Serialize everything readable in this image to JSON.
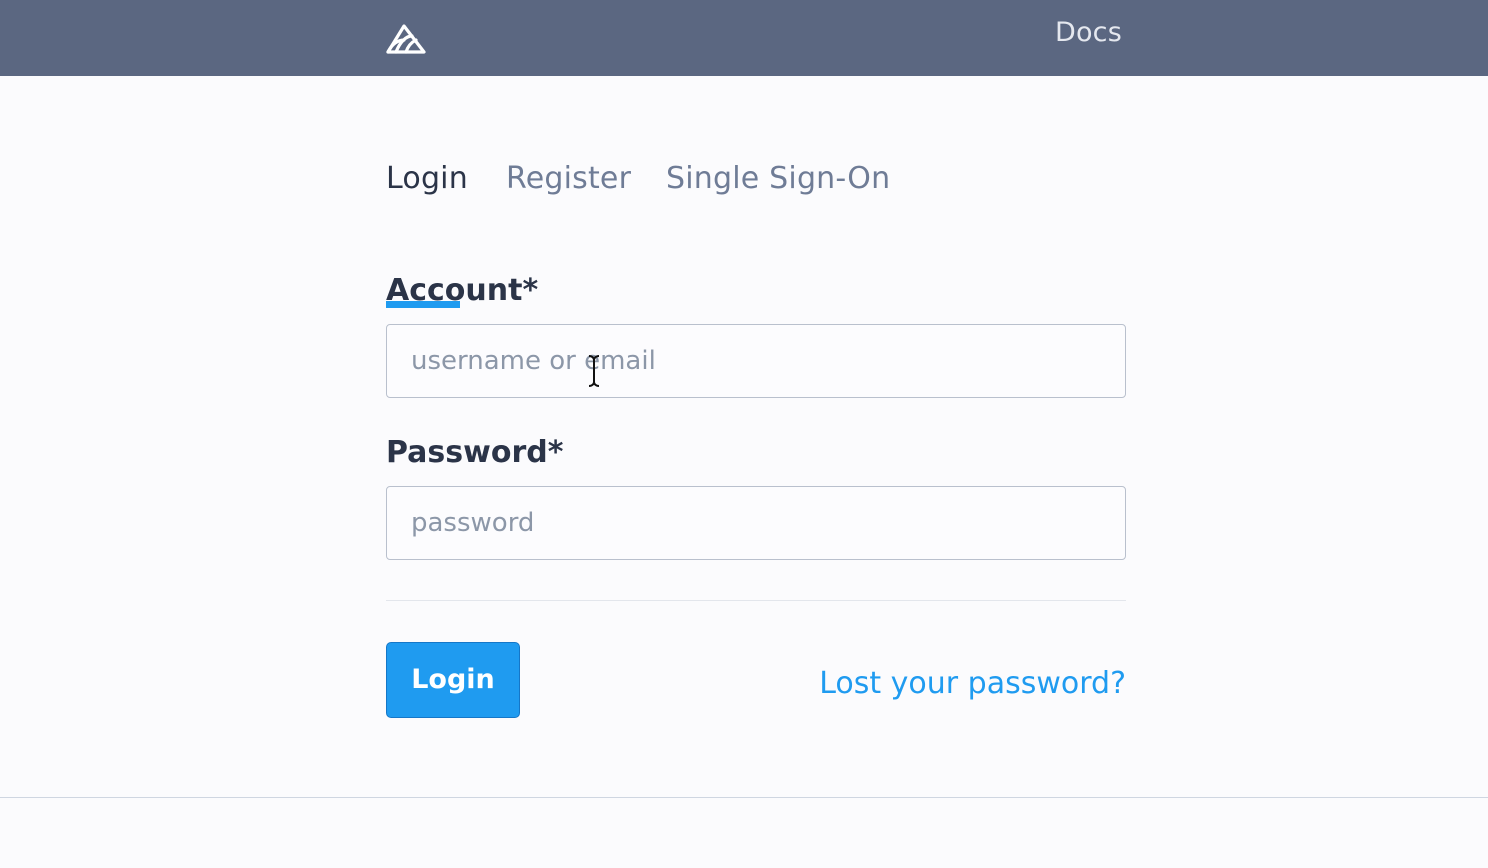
{
  "header": {
    "logo_icon": "sentry-logo-icon",
    "docs_label": "Docs"
  },
  "tabs": [
    {
      "label": "Login",
      "active": true
    },
    {
      "label": "Register",
      "active": false
    },
    {
      "label": "Single Sign-On",
      "active": false
    }
  ],
  "form": {
    "account": {
      "label": "Account*",
      "value": "",
      "placeholder": "username or email"
    },
    "password": {
      "label": "Password*",
      "value": "",
      "placeholder": "password"
    },
    "submit_label": "Login",
    "lost_password_label": "Lost your password?"
  },
  "colors": {
    "header_bg": "#5b6781",
    "accent": "#1f9bf0",
    "text_dark": "#2b3448",
    "text_muted": "#6f7c96"
  }
}
